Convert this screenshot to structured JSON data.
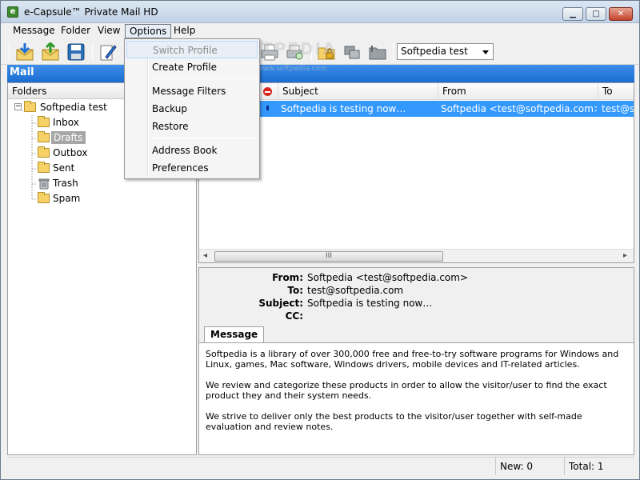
{
  "window": {
    "title": "e-Capsule™ Private Mail HD",
    "minimize_glyph": "▁",
    "maximize_glyph": "□",
    "close_glyph": "✕",
    "app_icon_glyph": "e"
  },
  "menubar": {
    "items": [
      "Message",
      "Folder",
      "View",
      "Options",
      "Help"
    ],
    "open_item": "Options"
  },
  "toolbar": {
    "icons": [
      "receive-mail-icon",
      "send-mail-icon",
      "save-icon",
      "compose-icon",
      "print-icon",
      "print-preview-icon",
      "lock-folder-icon",
      "copy-icon",
      "move-folder-icon"
    ],
    "profile_select": {
      "selected": "Softpedia test"
    }
  },
  "mail_header": {
    "title": "Mail"
  },
  "folders": {
    "header": "Folders",
    "root": {
      "label": "Softpedia test",
      "expander": "−"
    },
    "items": [
      {
        "label": "Inbox",
        "icon": "inbox-folder-icon"
      },
      {
        "label": "Drafts",
        "icon": "drafts-folder-icon",
        "selected": true
      },
      {
        "label": "Outbox",
        "icon": "outbox-folder-icon"
      },
      {
        "label": "Sent",
        "icon": "sent-folder-icon"
      },
      {
        "label": "Trash",
        "icon": "trash-icon"
      },
      {
        "label": "Spam",
        "icon": "spam-folder-icon"
      }
    ]
  },
  "message_list": {
    "columns": [
      "Subject",
      "From",
      "To"
    ],
    "rows": [
      {
        "subject": "Softpedia is testing now…",
        "from": "Softpedia <test@softpedia.com>",
        "to": "test@softpedia.com"
      }
    ],
    "scroll_grip": "III",
    "scroll_left": "◂",
    "scroll_right": "▸"
  },
  "preview": {
    "labels": {
      "from": "From:",
      "to": "To:",
      "subject": "Subject:",
      "cc": "CC:"
    },
    "from": "Softpedia <test@softpedia.com>",
    "to": "test@softpedia.com",
    "subject": "Softpedia is testing now…",
    "cc": "",
    "tab": "Message",
    "body": [
      "Softpedia is a library of over 300,000 free and free-to-try software programs for Windows and Linux, games, Mac software, Windows drivers, mobile devices and IT-related articles.",
      "We review and categorize these products in order to allow the visitor/user to find the exact product they and their system needs.",
      "We strive to deliver only the best products to the visitor/user together with self-made evaluation and review notes."
    ]
  },
  "statusbar": {
    "new": "New: 0",
    "total": "Total: 1"
  },
  "options_menu": {
    "items": [
      {
        "label": "Switch Profile",
        "disabled": true
      },
      {
        "label": "Create Profile"
      },
      {
        "label": "Message Filters"
      },
      {
        "label": "Backup"
      },
      {
        "label": "Restore"
      },
      {
        "label": "Address Book"
      },
      {
        "label": "Preferences"
      }
    ]
  },
  "watermark": {
    "text": "SOFTPEDIA",
    "sub": "www.softpedia.com"
  },
  "colors": {
    "accent": "#1b6dd1",
    "selection": "#3399ff"
  }
}
